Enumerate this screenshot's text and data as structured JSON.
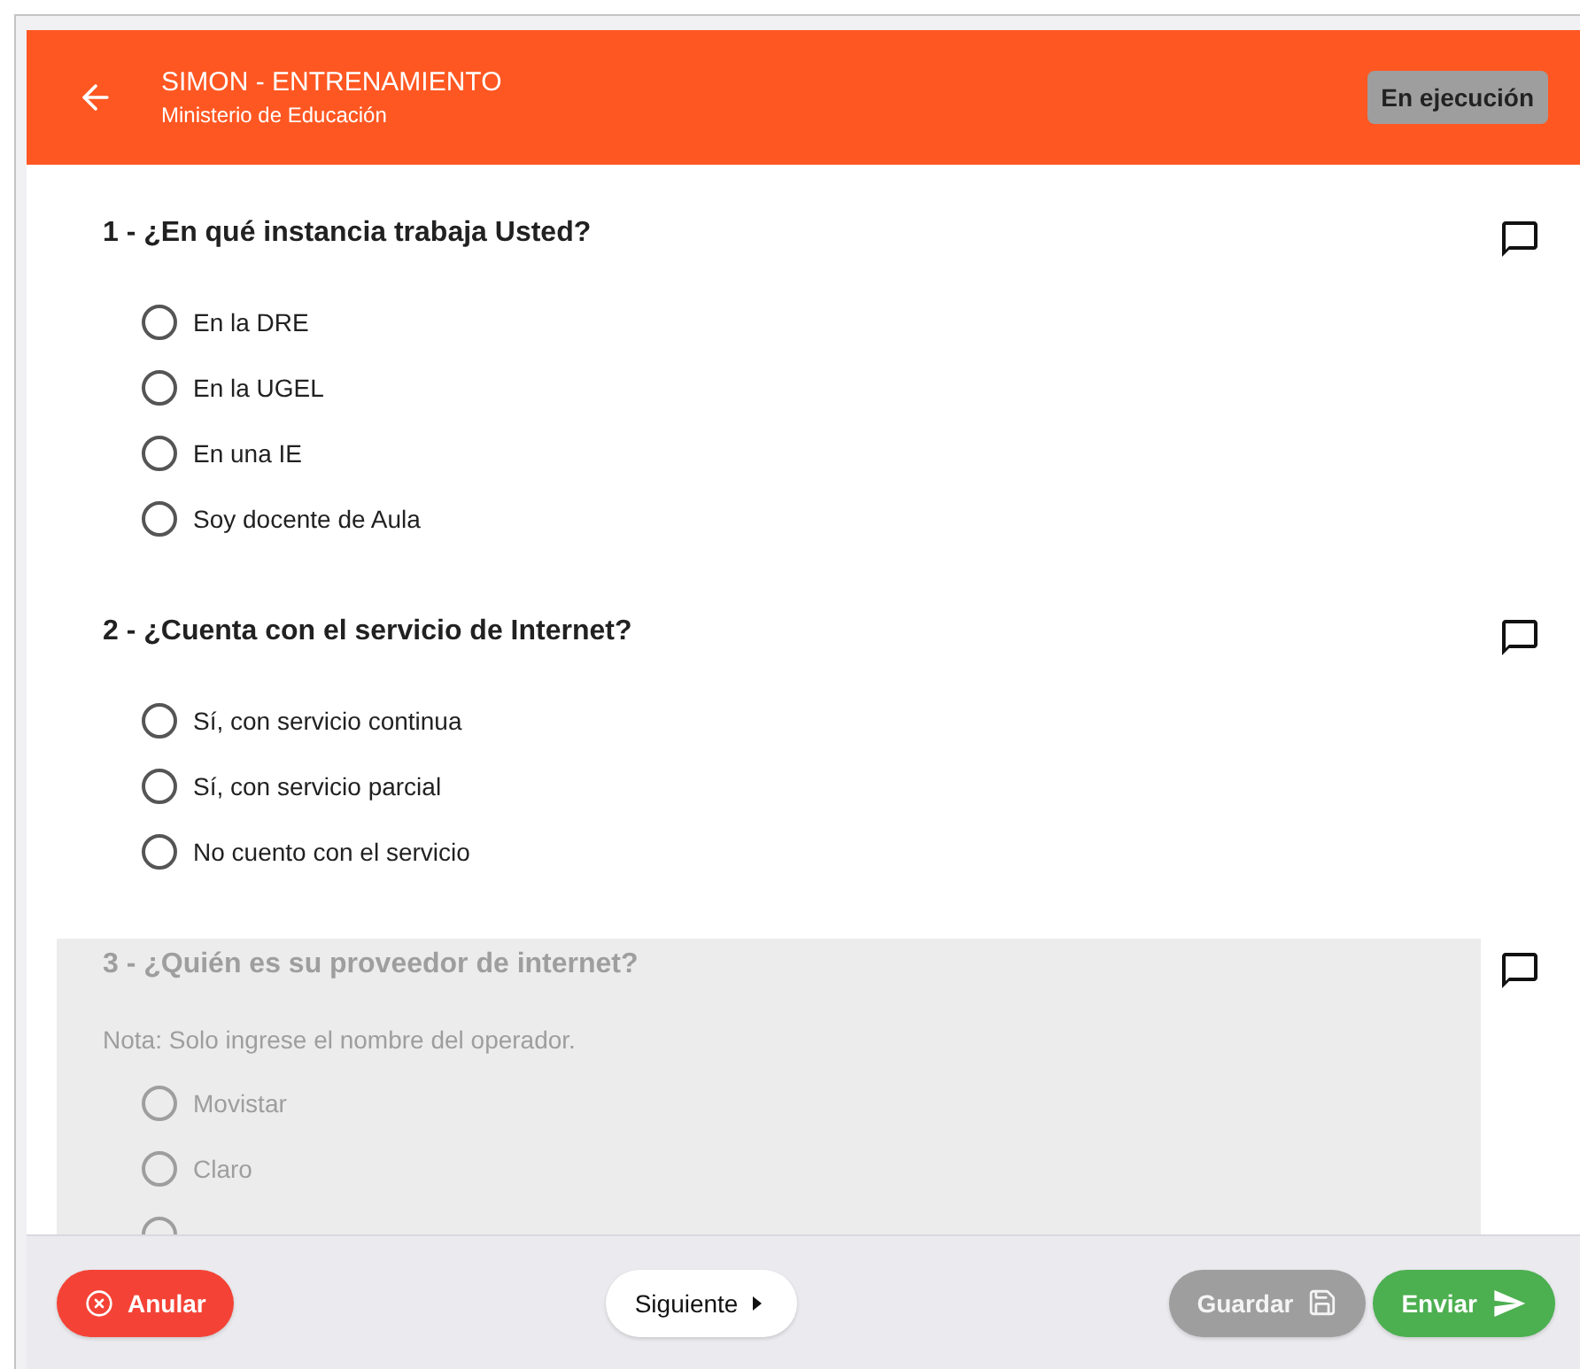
{
  "header": {
    "title": "SIMON - ENTRENAMIENTO",
    "subtitle": "Ministerio de Educación",
    "status": "En ejecución"
  },
  "questions": [
    {
      "title": "1 - ¿En qué instancia trabaja Usted?",
      "disabled": false,
      "options": [
        {
          "label": "En la DRE",
          "selected": false
        },
        {
          "label": "En la UGEL",
          "selected": false
        },
        {
          "label": "En una IE",
          "selected": false
        },
        {
          "label": "Soy docente de Aula",
          "selected": false
        }
      ]
    },
    {
      "title": "2 - ¿Cuenta con el servicio de Internet?",
      "disabled": false,
      "options": [
        {
          "label": "Sí, con servicio continua",
          "selected": false
        },
        {
          "label": "Sí, con servicio parcial",
          "selected": false
        },
        {
          "label": "No cuento con el servicio",
          "selected": false
        }
      ]
    },
    {
      "title": "3 - ¿Quién es su proveedor de internet?",
      "note": "Nota: Solo ingrese el nombre del operador.",
      "disabled": true,
      "options": [
        {
          "label": "Movistar",
          "selected": false
        },
        {
          "label": "Claro",
          "selected": false
        },
        {
          "selected": false
        }
      ]
    }
  ],
  "footer": {
    "cancel": "Anular",
    "next": "Siguiente",
    "save": "Guardar",
    "send": "Enviar"
  }
}
